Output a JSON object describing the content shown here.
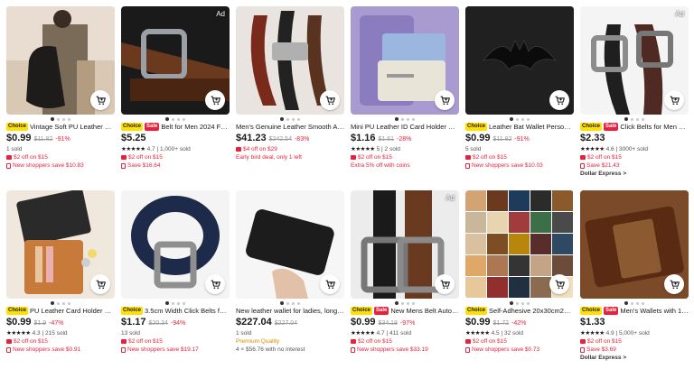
{
  "colors": {
    "accent": "#e8223d",
    "choice": "#ffe000"
  },
  "products": [
    {
      "ad": "",
      "tags": [
        "Choice"
      ],
      "title": "Vintage Soft PU Leather Ladi...",
      "price": "$0.99",
      "old": "$11.82",
      "disc": "-91%",
      "lines": [
        {
          "type": "plain",
          "text": "1 sold"
        },
        {
          "type": "coupon",
          "text": "$2 off on $15"
        },
        {
          "type": "shop",
          "text": "New shoppers save $10.83"
        }
      ]
    },
    {
      "ad": "Ad",
      "tags": [
        "Choice",
        "Sale"
      ],
      "title": "Belt for Men 2024 Famo...",
      "price": "$5.25",
      "old": "",
      "disc": "",
      "lines": [
        {
          "type": "rating",
          "stars": "★★★★★",
          "text": "4.7 | 1,000+ sold"
        },
        {
          "type": "coupon",
          "text": "$2 off on $15"
        },
        {
          "type": "shop",
          "text": "Save $16.64"
        }
      ]
    },
    {
      "ad": "",
      "tags": [],
      "title": "Men's Genuine Leather Smooth Aut...",
      "price": "$41.23",
      "old": "$242.54",
      "disc": "-83%",
      "lines": [
        {
          "type": "coupon",
          "text": "$4 off on $29"
        },
        {
          "type": "red",
          "text": "Early bird deal, only 1 left"
        }
      ]
    },
    {
      "ad": "",
      "tags": [],
      "title": "Mini PU Leather ID Card Holder Coi...",
      "price": "$1.16",
      "old": "$1.61",
      "disc": "-28%",
      "lines": [
        {
          "type": "rating",
          "stars": "★★★★★",
          "text": "5 | 2 sold"
        },
        {
          "type": "coupon",
          "text": "$2 off on $15"
        },
        {
          "type": "red",
          "text": "Extra 5% off with coins"
        }
      ]
    },
    {
      "ad": "",
      "tags": [
        "Choice"
      ],
      "title": "Leather Bat Wallet Personaliz...",
      "price": "$0.99",
      "old": "$11.82",
      "disc": "-91%",
      "lines": [
        {
          "type": "plain",
          "text": "5 sold"
        },
        {
          "type": "coupon",
          "text": "$2 off on $15"
        },
        {
          "type": "shop",
          "text": "New shoppers save $10.03"
        }
      ]
    },
    {
      "ad": "Ad",
      "tags": [
        "Choice",
        "Sale"
      ],
      "title": "Click Belts for Men Luxu...",
      "price": "$2.33",
      "old": "",
      "disc": "",
      "lines": [
        {
          "type": "rating",
          "stars": "★★★★★",
          "text": "4.6 | 3000+ sold"
        },
        {
          "type": "coupon",
          "text": "$2 off on $15"
        },
        {
          "type": "shop",
          "text": "Save $21.43"
        },
        {
          "type": "bold",
          "text": "Dollar Express >"
        }
      ]
    },
    {
      "ad": "",
      "tags": [
        "Choice"
      ],
      "title": "PU Leather Card Holder Busi...",
      "price": "$0.99",
      "old": "$1.9",
      "disc": "-47%",
      "lines": [
        {
          "type": "rating",
          "stars": "★★★★★",
          "text": "4.3 | 215 sold"
        },
        {
          "type": "coupon",
          "text": "$2 off on $15"
        },
        {
          "type": "shop",
          "text": "New shoppers save $0.91"
        }
      ]
    },
    {
      "ad": "",
      "tags": [
        "Choice"
      ],
      "title": "3.5cm Width Click Belts for M...",
      "price": "$1.17",
      "old": "$20.34",
      "disc": "-94%",
      "lines": [
        {
          "type": "plain",
          "text": "13 sold"
        },
        {
          "type": "coupon",
          "text": "$2 off on $15"
        },
        {
          "type": "shop",
          "text": "New shoppers save $19.17"
        }
      ]
    },
    {
      "ad": "",
      "tags": [],
      "title": "New leather wallet for ladies, long st...",
      "price": "$227.04",
      "old": "$227.04",
      "disc": "",
      "lines": [
        {
          "type": "plain",
          "text": "1 sold"
        },
        {
          "type": "orange",
          "text": "Premium Quality"
        },
        {
          "type": "plain",
          "text": "4 × $56.76 with no interest"
        }
      ]
    },
    {
      "ad": "Ad",
      "tags": [
        "Choice",
        "Sale"
      ],
      "title": "New Mens Belt Automati...",
      "price": "$0.99",
      "old": "$34.18",
      "disc": "-97%",
      "lines": [
        {
          "type": "rating",
          "stars": "★★★★★",
          "text": "4.7 | 411 sold"
        },
        {
          "type": "coupon",
          "text": "$2 off on $15"
        },
        {
          "type": "shop",
          "text": "New shoppers save $33.19"
        }
      ]
    },
    {
      "ad": "",
      "tags": [
        "Choice"
      ],
      "title": "Self-Adhesive 20x30cm25x6...",
      "price": "$0.99",
      "old": "$1.72",
      "disc": "-42%",
      "lines": [
        {
          "type": "rating",
          "stars": "★★★★★",
          "text": "4.5 | 32 sold"
        },
        {
          "type": "coupon",
          "text": "$2 off on $15"
        },
        {
          "type": "shop",
          "text": "New shoppers save $0.73"
        }
      ]
    },
    {
      "ad": "",
      "tags": [
        "Choice",
        "Sale"
      ],
      "title": "Men's Wallets with 100 ...",
      "price": "$1.33",
      "old": "",
      "disc": "",
      "lines": [
        {
          "type": "rating",
          "stars": "★★★★★",
          "text": "4.9 | 5,000+ sold"
        },
        {
          "type": "coupon",
          "text": "$2 off on $15"
        },
        {
          "type": "shop",
          "text": "Save $3.69"
        },
        {
          "type": "bold",
          "text": "Dollar Express >"
        }
      ]
    }
  ]
}
